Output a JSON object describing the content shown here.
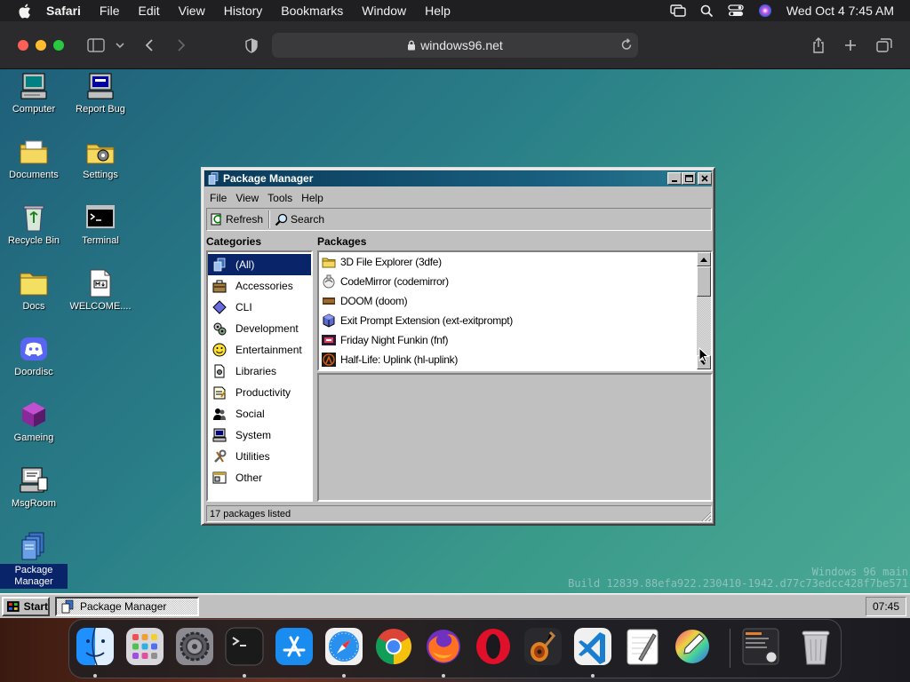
{
  "macos": {
    "menubar": {
      "app": "Safari",
      "menus": [
        "File",
        "Edit",
        "View",
        "History",
        "Bookmarks",
        "Window",
        "Help"
      ],
      "clock": "Wed Oct 4  7:45 AM"
    },
    "safari": {
      "url": "windows96.net"
    }
  },
  "desktop": {
    "icons": [
      {
        "label": "Computer"
      },
      {
        "label": "Report Bug"
      },
      {
        "label": "Documents"
      },
      {
        "label": "Settings"
      },
      {
        "label": "Recycle Bin"
      },
      {
        "label": "Terminal"
      },
      {
        "label": "Docs"
      },
      {
        "label": "WELCOME...."
      },
      {
        "label": "Doordisc"
      },
      {
        "label": "Gameing"
      },
      {
        "label": "MsgRoom"
      },
      {
        "label": "Package Manager"
      }
    ],
    "watermark": {
      "line1": "Windows 96 main",
      "line2": "Build 12839.88efa922.230410-1942.d77c73edcc428f7be571"
    }
  },
  "window": {
    "title": "Package Manager",
    "menu": [
      "File",
      "View",
      "Tools",
      "Help"
    ],
    "toolbar": {
      "refresh": "Refresh",
      "search": "Search"
    },
    "categories_header": "Categories",
    "packages_header": "Packages",
    "categories": [
      "(All)",
      "Accessories",
      "CLI",
      "Development",
      "Entertainment",
      "Libraries",
      "Productivity",
      "Social",
      "System",
      "Utilities",
      "Other"
    ],
    "packages": [
      "3D File Explorer (3dfe)",
      "CodeMirror (codemirror)",
      "DOOM (doom)",
      "Exit Prompt Extension (ext-exitprompt)",
      "Friday Night Funkin (fnf)",
      "Half-Life: Uplink (hl-uplink)"
    ],
    "status": "17 packages listed"
  },
  "taskbar": {
    "start": "Start",
    "active_task": "Package Manager",
    "clock": "07:45"
  },
  "dock": {
    "apps": [
      "finder-icon",
      "launchpad-icon",
      "system-settings-icon",
      "terminal-icon",
      "app-store-icon",
      "safari-icon",
      "chrome-icon",
      "firefox-icon",
      "opera-icon",
      "garageband-icon",
      "vscode-icon",
      "textedit-icon",
      "color-picker-icon",
      "app-preview-icon",
      "trash-icon"
    ]
  }
}
